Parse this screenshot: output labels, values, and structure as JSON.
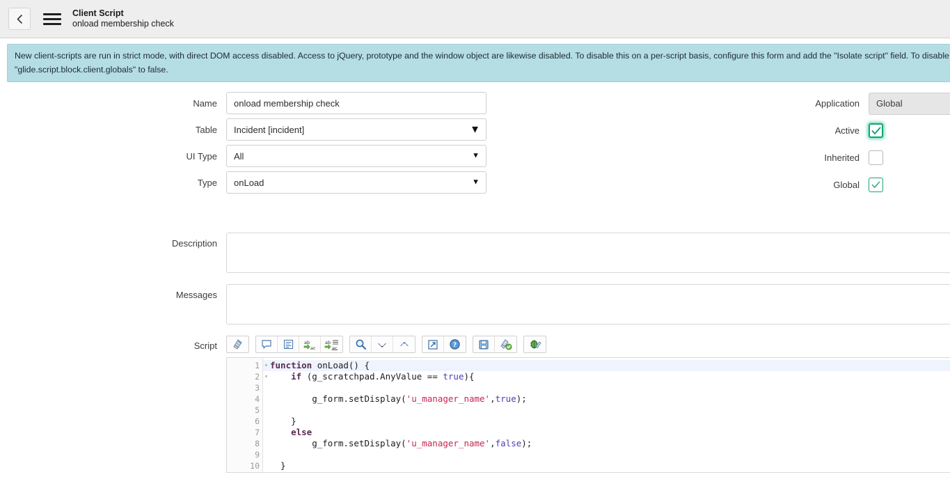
{
  "header": {
    "back_icon": "chevron-left-icon",
    "menu_icon": "hamburger-menu-icon",
    "title": "Client Script",
    "subtitle": "onload membership check"
  },
  "banner": {
    "line1": "New client-scripts are run in strict mode, with direct DOM access disabled. Access to jQuery, prototype and the window object are likewise disabled. To disable this on a per-script basis, configure this form and add the \"Isolate script\" field. To disable this globally, set the property",
    "line2": "\"glide.script.block.client.globals\" to false.",
    "background": "#b5dde4"
  },
  "form": {
    "left": {
      "name": {
        "label": "Name",
        "value": "onload membership check"
      },
      "table": {
        "label": "Table",
        "value": "Incident [incident]",
        "arrow": "▼"
      },
      "ui_type": {
        "label": "UI Type",
        "value": "All",
        "arrow": "▼"
      },
      "type": {
        "label": "Type",
        "value": "onLoad",
        "arrow": "▼"
      },
      "description": {
        "label": "Description",
        "value": ""
      },
      "messages": {
        "label": "Messages",
        "value": ""
      },
      "script": {
        "label": "Script"
      }
    },
    "right": {
      "application": {
        "label": "Application",
        "value": "Global"
      },
      "active": {
        "label": "Active",
        "checked": true,
        "focused": true
      },
      "inherited": {
        "label": "Inherited",
        "checked": false,
        "focused": false
      },
      "global": {
        "label": "Global",
        "checked": true,
        "focused": false
      }
    }
  },
  "script_toolbar": {
    "groups": [
      [
        {
          "name": "format-code-icon"
        }
      ],
      [
        {
          "name": "comment-icon"
        },
        {
          "name": "align-text-icon"
        },
        {
          "name": "replace-word-icon"
        },
        {
          "name": "replace-all-icon"
        }
      ],
      [
        {
          "name": "search-icon"
        },
        {
          "name": "find-next-icon"
        },
        {
          "name": "find-previous-icon"
        }
      ],
      [
        {
          "name": "popout-editor-icon"
        },
        {
          "name": "help-icon"
        }
      ],
      [
        {
          "name": "save-icon"
        },
        {
          "name": "syntax-check-icon"
        }
      ],
      [
        {
          "name": "debug-script-icon"
        }
      ]
    ]
  },
  "code_editor": {
    "active_line": 1,
    "fold_lines": [
      1,
      2
    ],
    "lines": [
      {
        "n": 1,
        "tokens": [
          {
            "t": "function",
            "c": "kw"
          },
          {
            "t": " onLoad() {",
            "c": "fn"
          }
        ]
      },
      {
        "n": 2,
        "tokens": [
          {
            "t": "    ",
            "c": "fn"
          },
          {
            "t": "if",
            "c": "kw"
          },
          {
            "t": " (g_scratchpad.AnyValue == ",
            "c": "fn"
          },
          {
            "t": "true",
            "c": "bool"
          },
          {
            "t": "){",
            "c": "fn"
          }
        ]
      },
      {
        "n": 3,
        "tokens": [
          {
            "t": "",
            "c": "fn"
          }
        ]
      },
      {
        "n": 4,
        "tokens": [
          {
            "t": "        g_form.setDisplay(",
            "c": "fn"
          },
          {
            "t": "'u_manager_name'",
            "c": "str"
          },
          {
            "t": ",",
            "c": "fn"
          },
          {
            "t": "true",
            "c": "bool"
          },
          {
            "t": ");",
            "c": "fn"
          }
        ]
      },
      {
        "n": 5,
        "tokens": [
          {
            "t": "",
            "c": "fn"
          }
        ]
      },
      {
        "n": 6,
        "tokens": [
          {
            "t": "    }",
            "c": "fn"
          }
        ]
      },
      {
        "n": 7,
        "tokens": [
          {
            "t": "    ",
            "c": "fn"
          },
          {
            "t": "else",
            "c": "kw"
          }
        ]
      },
      {
        "n": 8,
        "tokens": [
          {
            "t": "        g_form.setDisplay(",
            "c": "fn"
          },
          {
            "t": "'u_manager_name'",
            "c": "str"
          },
          {
            "t": ",",
            "c": "fn"
          },
          {
            "t": "false",
            "c": "bool"
          },
          {
            "t": ");",
            "c": "fn"
          }
        ]
      },
      {
        "n": 9,
        "tokens": [
          {
            "t": "",
            "c": "fn"
          }
        ]
      },
      {
        "n": 10,
        "tokens": [
          {
            "t": "  }",
            "c": "fn"
          }
        ]
      }
    ]
  }
}
